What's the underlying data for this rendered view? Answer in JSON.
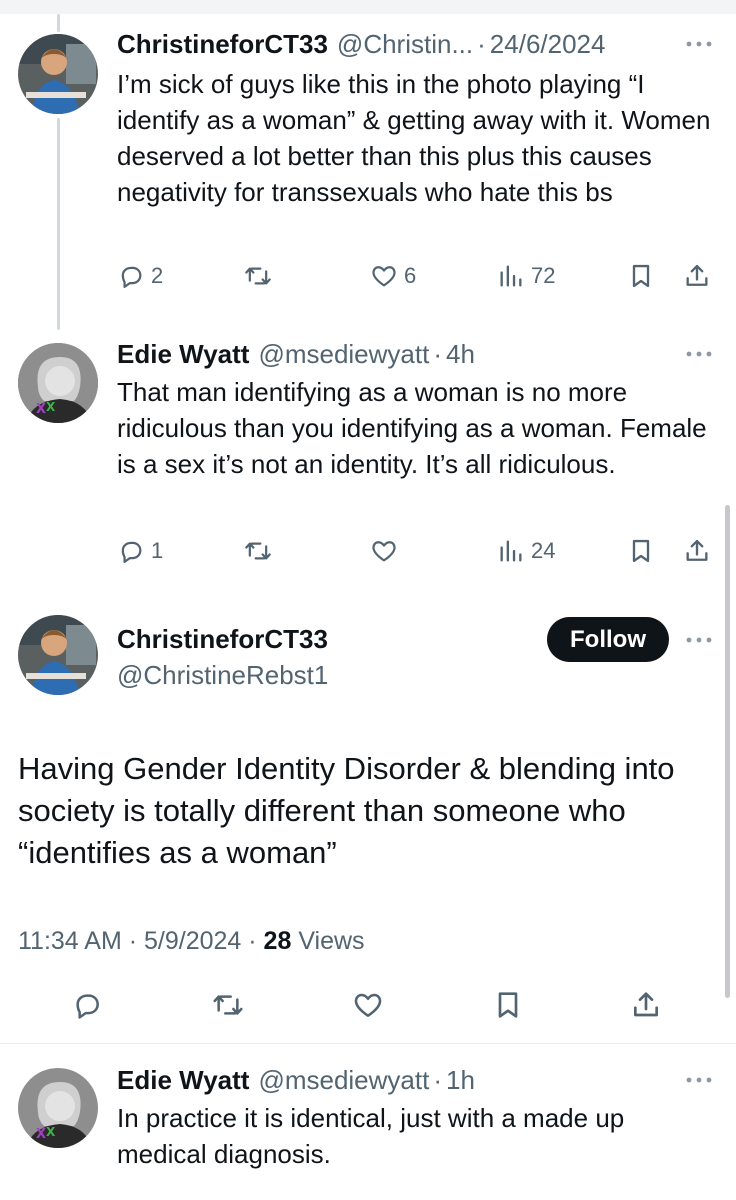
{
  "tweets": [
    {
      "name": "ChristineforCT33",
      "handle": "@Christin...",
      "time": "24/6/2024",
      "text": "I’m sick of guys like this in the photo playing “I identify as a woman” & getting away with it. Women deserved a lot better than this plus this causes negativity for transsexuals who hate this bs",
      "replies": "2",
      "retweets": "",
      "likes": "6",
      "views": "72"
    },
    {
      "name": "Edie Wyatt",
      "handle": "@msediewyatt",
      "time": "4h",
      "text": "That man identifying as a woman is no more ridiculous than you identifying as a woman. Female is a sex it’s not an identity. It’s all ridiculous.",
      "replies": "1",
      "retweets": "",
      "likes": "",
      "views": "24"
    }
  ],
  "main_tweet": {
    "name": "ChristineforCT33",
    "handle": "@ChristineRebst1",
    "follow_label": "Follow",
    "text": "Having Gender Identity Disorder & blending into society is totally different than someone who “identifies as a woman”",
    "time": "11:34 AM",
    "date": "5/9/2024",
    "views_count": "28",
    "views_label": "Views"
  },
  "reply": {
    "name": "Edie Wyatt",
    "handle": "@msediewyatt",
    "time": "1h",
    "text": "In practice it is identical, just with a made up medical diagnosis."
  },
  "icons": {
    "reply": "reply-icon",
    "retweet": "retweet-icon",
    "like": "heart-icon",
    "views": "views-icon",
    "bookmark": "bookmark-icon",
    "share": "share-icon",
    "more": "more-icon"
  },
  "colors": {
    "text": "#0f1419",
    "muted": "#536471",
    "thread_line": "#cfd9de",
    "follow_bg": "#0f1419"
  }
}
